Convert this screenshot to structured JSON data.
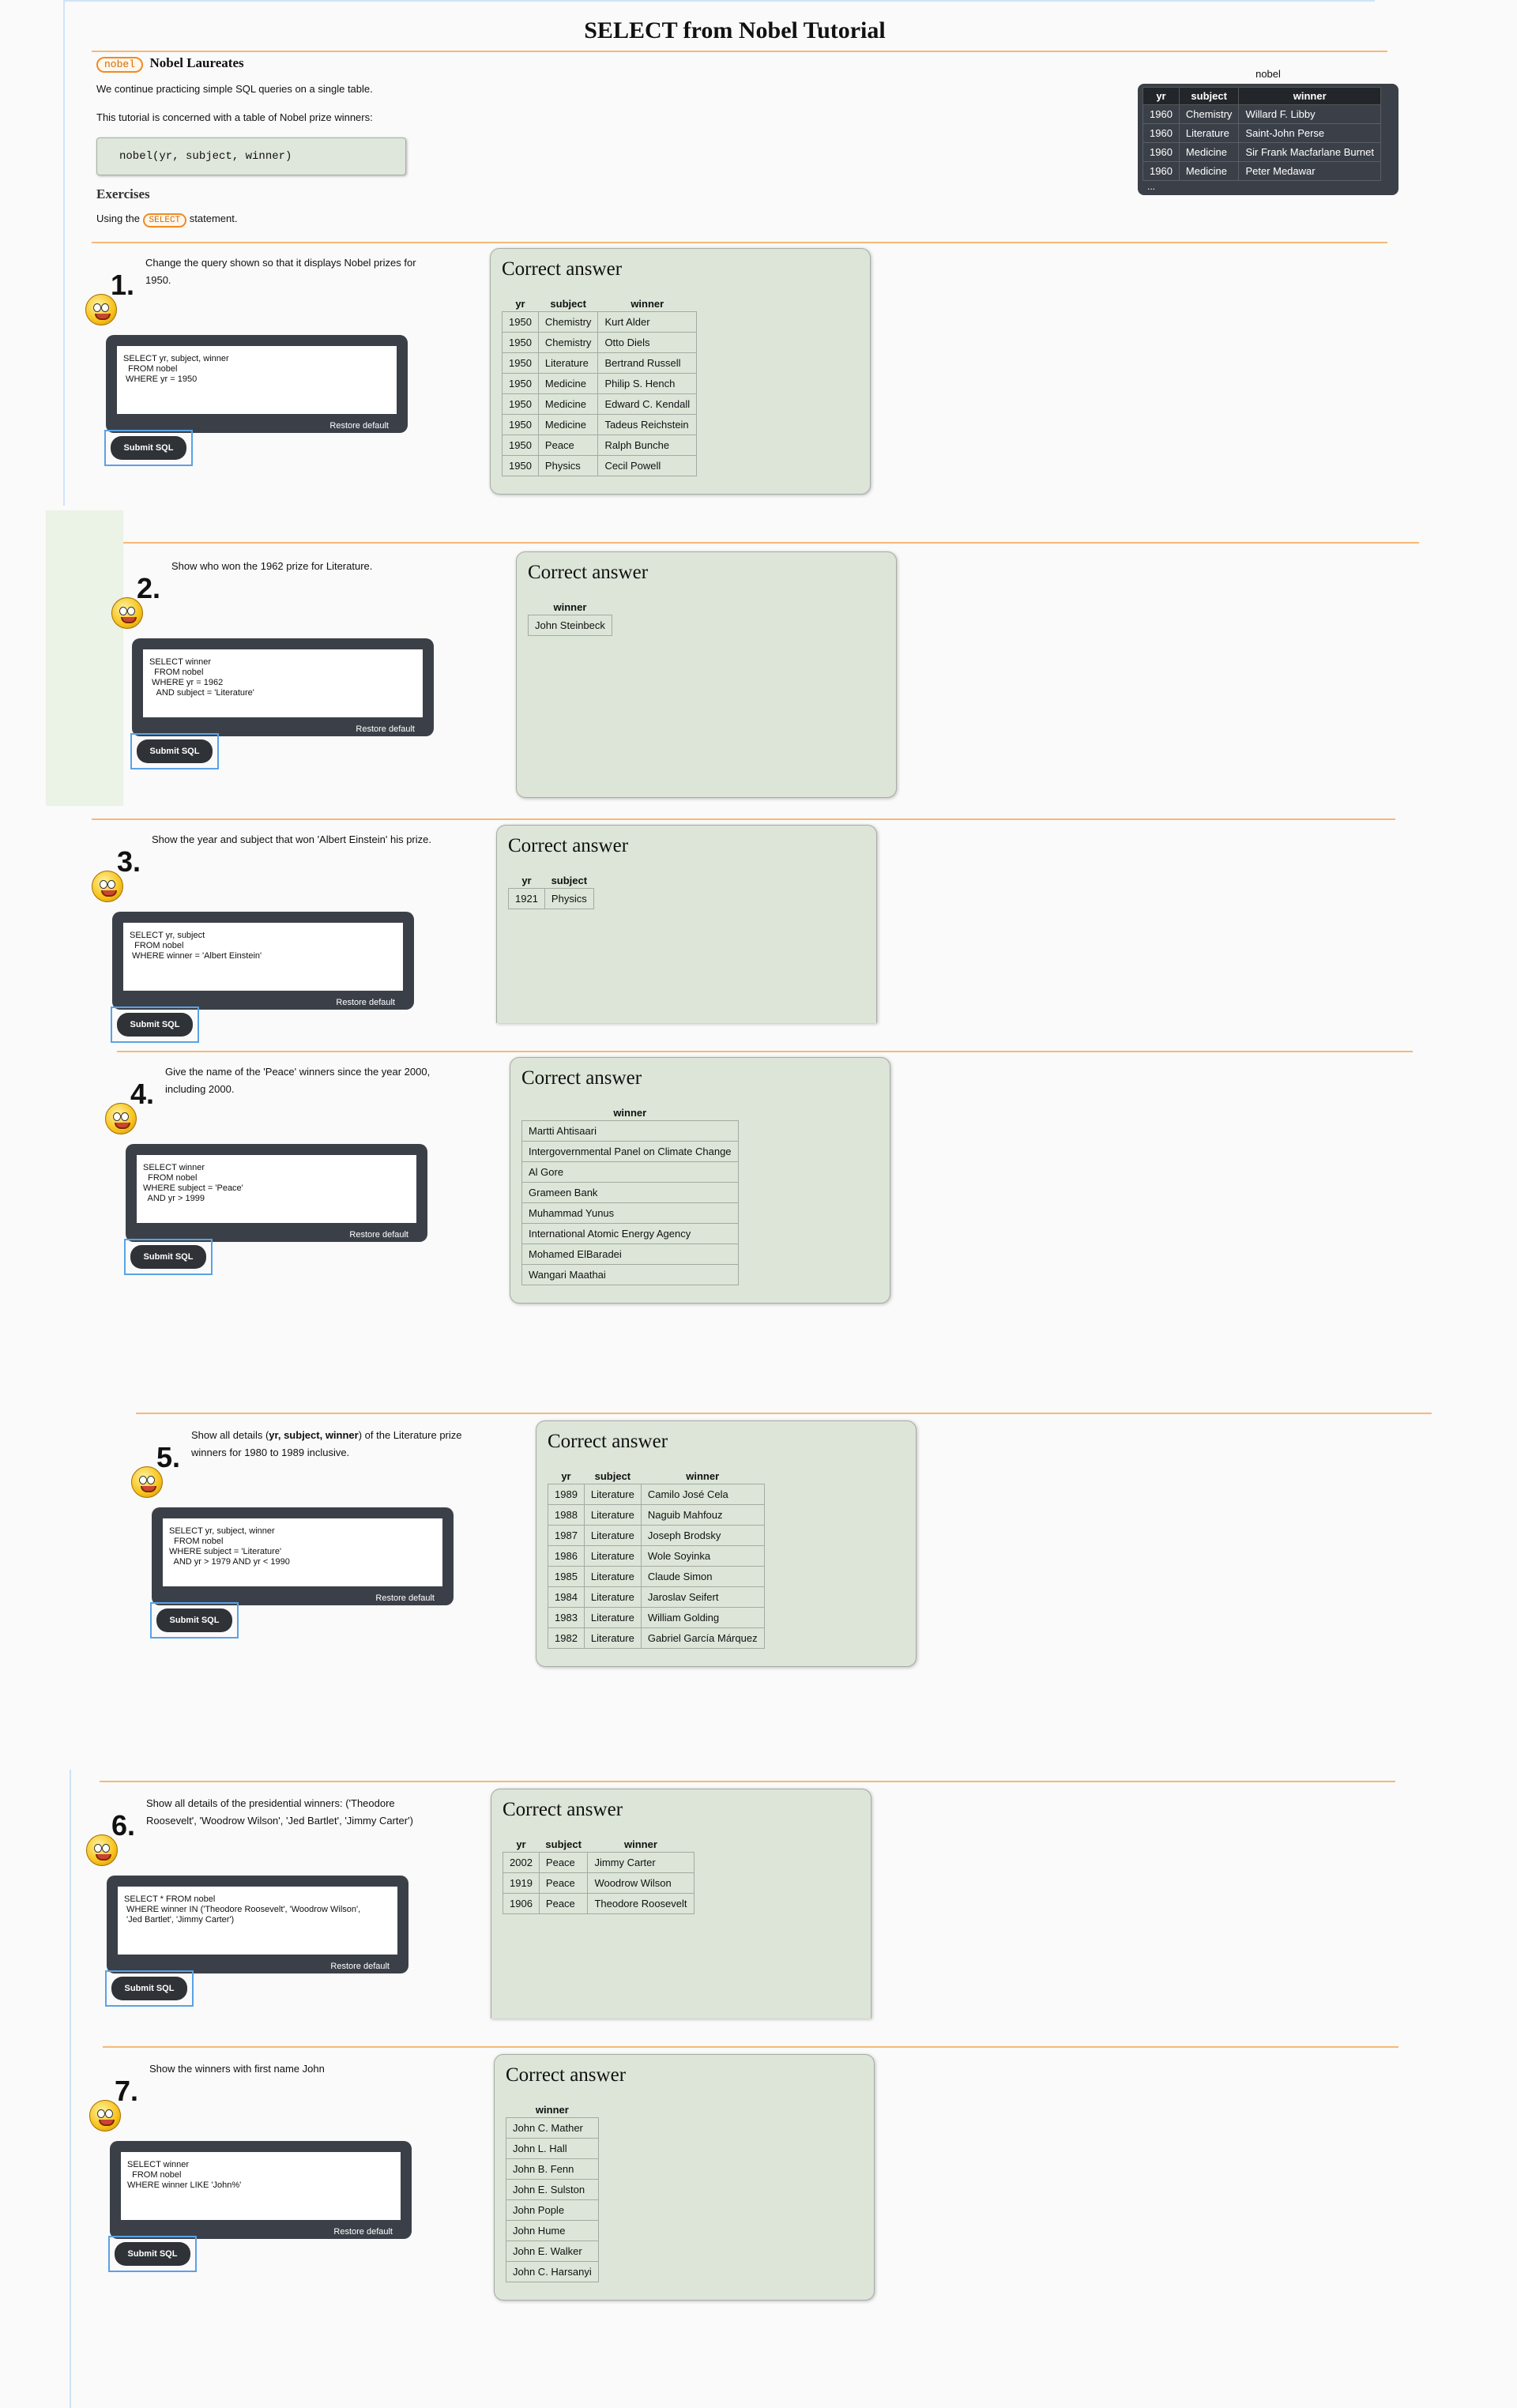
{
  "title": "SELECT from Nobel Tutorial",
  "intro": {
    "badge": "nobel",
    "heading": "Nobel Laureates",
    "line1": "We continue practicing simple SQL queries on a single table.",
    "line2": "This tutorial is concerned with a table of Nobel prize winners:",
    "schema": "nobel(yr, subject, winner)",
    "exercises_heading": "Exercises",
    "using_prefix": "Using the",
    "using_badge": "SELECT",
    "using_suffix": "statement."
  },
  "preview": {
    "caption": "nobel",
    "headers": [
      "yr",
      "subject",
      "winner"
    ],
    "rows": [
      [
        "1960",
        "Chemistry",
        "Willard F. Libby"
      ],
      [
        "1960",
        "Literature",
        "Saint-John Perse"
      ],
      [
        "1960",
        "Medicine",
        "Sir Frank Macfarlane Burnet"
      ],
      [
        "1960",
        "Medicine",
        "Peter Medawar"
      ]
    ],
    "more": "..."
  },
  "common": {
    "restore_label": "Restore default",
    "submit_label": "Submit SQL",
    "answer_heading": "Correct answer"
  },
  "exercises": [
    {
      "num": "1.",
      "question": "Change the query shown so that it displays Nobel prizes for 1950.",
      "sql": "SELECT yr, subject, winner\n  FROM nobel\n WHERE yr = 1950",
      "headers": [
        "yr",
        "subject",
        "winner"
      ],
      "rows": [
        [
          "1950",
          "Chemistry",
          "Kurt Alder"
        ],
        [
          "1950",
          "Chemistry",
          "Otto Diels"
        ],
        [
          "1950",
          "Literature",
          "Bertrand Russell"
        ],
        [
          "1950",
          "Medicine",
          "Philip S. Hench"
        ],
        [
          "1950",
          "Medicine",
          "Edward C. Kendall"
        ],
        [
          "1950",
          "Medicine",
          "Tadeus Reichstein"
        ],
        [
          "1950",
          "Peace",
          "Ralph Bunche"
        ],
        [
          "1950",
          "Physics",
          "Cecil Powell"
        ]
      ]
    },
    {
      "num": "2.",
      "question": "Show who won the 1962 prize for Literature.",
      "sql": "SELECT winner\n  FROM nobel\n WHERE yr = 1962\n   AND subject = 'Literature'",
      "headers": [
        "winner"
      ],
      "rows": [
        [
          "John Steinbeck"
        ]
      ]
    },
    {
      "num": "3.",
      "question": "Show the year and subject that won 'Albert Einstein' his prize.",
      "sql": "SELECT yr, subject\n  FROM nobel\n WHERE winner = 'Albert Einstein'",
      "headers": [
        "yr",
        "subject"
      ],
      "rows": [
        [
          "1921",
          "Physics"
        ]
      ]
    },
    {
      "num": "4.",
      "question": "Give the name of the 'Peace' winners since the year 2000, including 2000.",
      "sql": "SELECT winner\n  FROM nobel\nWHERE subject = 'Peace'\n  AND yr > 1999",
      "headers": [
        "winner"
      ],
      "rows": [
        [
          "Martti Ahtisaari"
        ],
        [
          "Intergovernmental Panel on Climate Change"
        ],
        [
          "Al Gore"
        ],
        [
          "Grameen Bank"
        ],
        [
          "Muhammad Yunus"
        ],
        [
          "International Atomic Energy Agency"
        ],
        [
          "Mohamed ElBaradei"
        ],
        [
          "Wangari Maathai"
        ]
      ]
    },
    {
      "num": "5.",
      "question_pre": "Show all details (",
      "question_bold": "yr, subject, winner",
      "question_post": ") of the Literature prize winners for 1980 to 1989 inclusive.",
      "sql": "SELECT yr, subject, winner\n  FROM nobel\nWHERE subject = 'Literature'\n  AND yr > 1979 AND yr < 1990",
      "headers": [
        "yr",
        "subject",
        "winner"
      ],
      "rows": [
        [
          "1989",
          "Literature",
          "Camilo José Cela"
        ],
        [
          "1988",
          "Literature",
          "Naguib Mahfouz"
        ],
        [
          "1987",
          "Literature",
          "Joseph Brodsky"
        ],
        [
          "1986",
          "Literature",
          "Wole Soyinka"
        ],
        [
          "1985",
          "Literature",
          "Claude Simon"
        ],
        [
          "1984",
          "Literature",
          "Jaroslav Seifert"
        ],
        [
          "1983",
          "Literature",
          "William Golding"
        ],
        [
          "1982",
          "Literature",
          "Gabriel García Márquez"
        ]
      ]
    },
    {
      "num": "6.",
      "question": "Show all details of the presidential winners: ('Theodore Roosevelt', 'Woodrow Wilson', 'Jed Bartlet', 'Jimmy Carter')",
      "sql": "SELECT * FROM nobel\n WHERE winner IN ('Theodore Roosevelt', 'Woodrow Wilson',\n 'Jed Bartlet', 'Jimmy Carter')",
      "headers": [
        "yr",
        "subject",
        "winner"
      ],
      "rows": [
        [
          "2002",
          "Peace",
          "Jimmy Carter"
        ],
        [
          "1919",
          "Peace",
          "Woodrow Wilson"
        ],
        [
          "1906",
          "Peace",
          "Theodore Roosevelt"
        ]
      ]
    },
    {
      "num": "7.",
      "question": "Show the winners with first name John",
      "sql": "SELECT winner\n  FROM nobel\nWHERE winner LIKE 'John%'",
      "headers": [
        "winner"
      ],
      "rows": [
        [
          "John C. Mather"
        ],
        [
          "John L. Hall"
        ],
        [
          "John B. Fenn"
        ],
        [
          "John E. Sulston"
        ],
        [
          "John Pople"
        ],
        [
          "John Hume"
        ],
        [
          "John E. Walker"
        ],
        [
          "John C. Harsanyi"
        ]
      ]
    }
  ]
}
